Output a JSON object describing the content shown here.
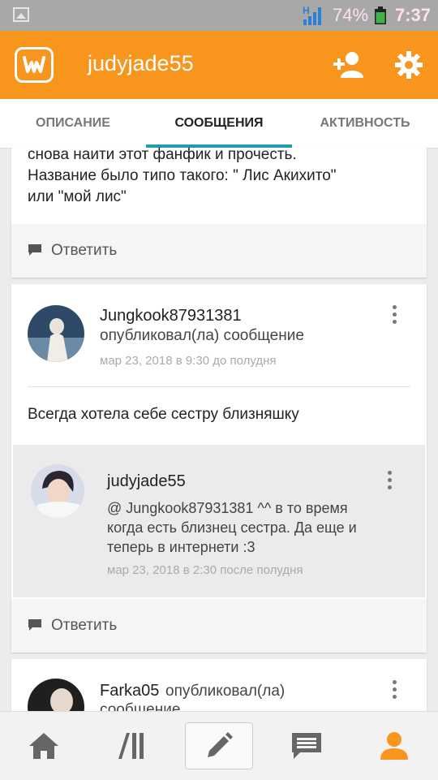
{
  "status_bar": {
    "battery_percent": "74%",
    "time": "7:37",
    "network_letter": "H",
    "accent_color": "#ffe0f0"
  },
  "header": {
    "username": "judyjade55",
    "logo_letter": "w",
    "icons": [
      "add-user-icon",
      "gear-icon"
    ],
    "brand_color": "#f7951d"
  },
  "tabs": [
    {
      "label": "ОПИСАНИЕ",
      "active": false
    },
    {
      "label": "СООБЩЕНИЯ",
      "active": true
    },
    {
      "label": "АКТИВНОСТЬ",
      "active": false
    }
  ],
  "tab_indicator_color": "#1a9fb0",
  "posts": [
    {
      "text_lines": [
        "снова наити этот фанфик и прочесть.",
        "Название было типо такого: \" Лис Акихито\"",
        "или \"мой лис\""
      ],
      "reply_label": "Ответить"
    },
    {
      "author": "Jungkook87931381",
      "action": "опубликовал(ла) сообщение",
      "timestamp": "мар 23, 2018 в 9:30 до полудня",
      "text": "Всегда хотела себе сестру близняшку",
      "reply": {
        "author": "judyjade55",
        "text_lines": [
          "@ Jungkook87931381  ^^ в то время",
          "когда есть близнец сестра. Да еще и",
          "теперь в интернети :3"
        ],
        "timestamp": "мар 23, 2018 в 2:30 после полудня"
      },
      "reply_label": "Ответить"
    },
    {
      "author": "Farka05",
      "action_line1": "опубликовал(ла)",
      "action_line2": "сообщение"
    }
  ],
  "bottom_nav": [
    "home-icon",
    "library-icon",
    "write-icon",
    "messages-icon",
    "profile-icon"
  ],
  "active_nav_color": "#f7951d"
}
